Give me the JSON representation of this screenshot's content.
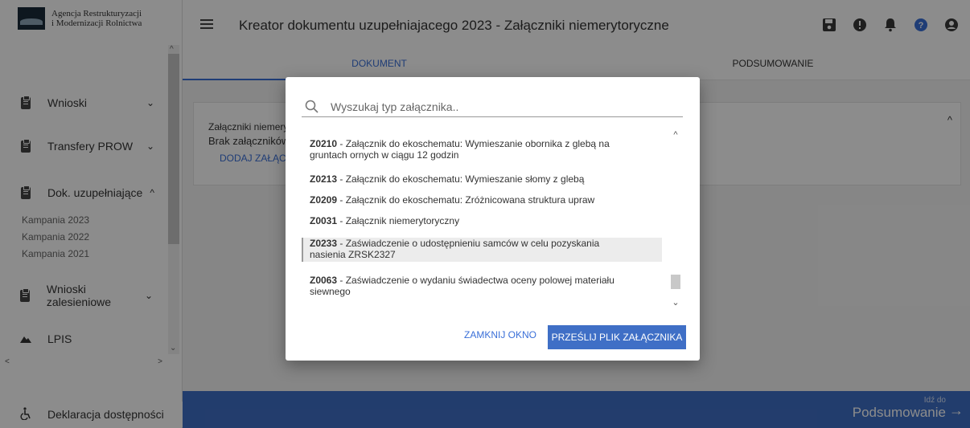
{
  "logo": {
    "line1": "Agencja Restrukturyzacji",
    "line2": "i Modernizacji Rolnictwa"
  },
  "sidebar": {
    "items": [
      {
        "label": "Wnioski",
        "chevron": "⌄"
      },
      {
        "label": "Transfery PROW",
        "chevron": "⌄"
      },
      {
        "label": "Dok. uzupełniające",
        "chevron": "^"
      },
      {
        "label": "Wnioski zalesieniowe",
        "chevron": "⌄"
      },
      {
        "label": "LPIS",
        "chevron": ""
      }
    ],
    "subitems": [
      "Kampania 2023",
      "Kampania 2022",
      "Kampania 2021"
    ],
    "footer_item": "Deklaracja dostępności"
  },
  "header": {
    "title": "Kreator dokumentu uzupełniajacego 2023 - Załączniki niemerytoryczne",
    "icons": [
      "save-icon",
      "alert-icon",
      "bell-icon",
      "help-icon",
      "user-icon"
    ],
    "accent_color": "#3a6fd8"
  },
  "tabs": [
    {
      "label": "DOKUMENT",
      "active": true
    },
    {
      "label": "PODSUMOWANIE",
      "active": false
    }
  ],
  "card": {
    "line1": "Załączniki niemerytoryczne",
    "line2": "Brak załączników",
    "action": "DODAJ ZAŁĄCZNIK"
  },
  "footer": {
    "small": "Idź do",
    "big": "Podsumowanie"
  },
  "modal": {
    "search_placeholder": "Wyszukaj typ załącznika..",
    "items": [
      {
        "code": "Z0210",
        "text": " - Załącznik do ekoschematu: Wymieszanie obornika z glebą na",
        "text2": "gruntach ornych w ciągu 12 godzin",
        "selected": false
      },
      {
        "code": "Z0213",
        "text": " - Załącznik do ekoschematu: Wymieszanie słomy z glebą",
        "text2": "",
        "selected": false
      },
      {
        "code": "Z0209",
        "text": " - Załącznik do ekoschematu: Zróżnicowana struktura upraw",
        "text2": "",
        "selected": false
      },
      {
        "code": "Z0031",
        "text": " - Załącznik niemerytoryczny",
        "text2": "",
        "selected": false
      },
      {
        "code": "Z0233",
        "text": " - Zaświadczenie o udostępnieniu samców w celu pozyskania",
        "text2": "nasienia ZRSK2327",
        "selected": true
      },
      {
        "code": "Z0063",
        "text": " - Zaświadczenie o wydaniu świadectwa oceny polowej materiału",
        "text2": "siewnego",
        "selected": false
      }
    ],
    "close_label": "ZAMKNIJ OKNO",
    "send_label": "PRZEŚLIJ PLIK ZAŁĄCZNIKA"
  }
}
